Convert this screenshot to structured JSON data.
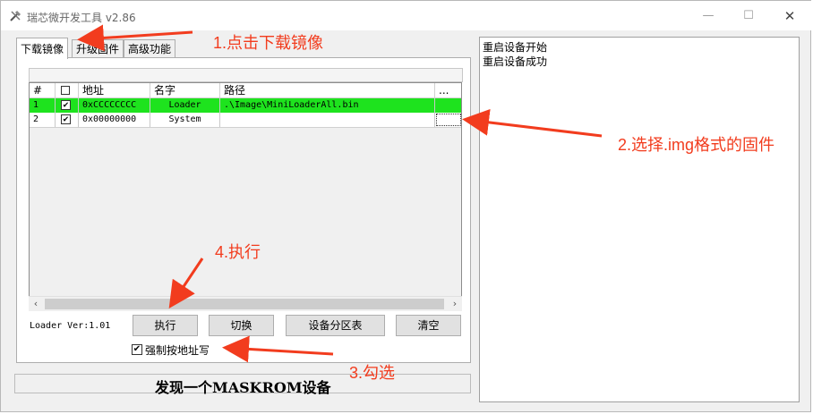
{
  "window": {
    "title": "瑞芯微开发工具 v2.86",
    "controls": {
      "minimize": "—",
      "maximize": "☐",
      "close": "✕"
    }
  },
  "tabs": [
    {
      "label": "下载镜像",
      "active": true
    },
    {
      "label": "升级固件",
      "active": false
    },
    {
      "label": "高级功能",
      "active": false
    }
  ],
  "grid": {
    "columns": [
      "#",
      "☐",
      "地址",
      "名字",
      "路径",
      "..."
    ],
    "rows": [
      {
        "index": "1",
        "checked": true,
        "address": "0xCCCCCCCC",
        "name": "Loader",
        "path": ".\\Image\\MiniLoaderAll.bin",
        "highlight": true
      },
      {
        "index": "2",
        "checked": true,
        "address": "0x00000000",
        "name": "System",
        "path": "",
        "highlight": false
      }
    ],
    "scroll_left": "‹",
    "scroll_right": "›"
  },
  "loader_ver": "Loader Ver:1.01",
  "buttons": {
    "execute": "执行",
    "switch": "切换",
    "partition_table": "设备分区表",
    "clear": "清空"
  },
  "force_write": {
    "label": "强制按地址写",
    "checked": true
  },
  "status": "发现一个MASKROM设备",
  "log": [
    "重启设备开始",
    "重启设备成功"
  ],
  "annotations": {
    "step1": "1.点击下载镜像",
    "step2": "2.选择.img格式的固件",
    "step3": "3.勾选",
    "step4": "4.执行"
  },
  "colors": {
    "annotation": "#f23c1e",
    "row_highlight": "#1ee31e"
  }
}
